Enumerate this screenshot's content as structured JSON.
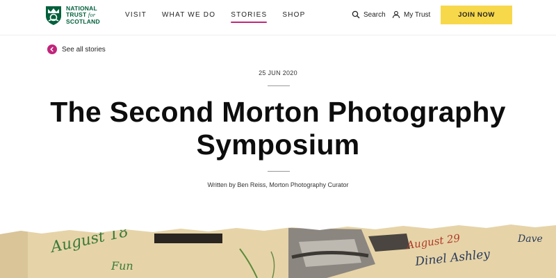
{
  "brand": {
    "line1": "NATIONAL",
    "line2_main": "TRUST",
    "line2_for": "for",
    "line3": "SCOTLAND",
    "color": "#00603c"
  },
  "nav": {
    "items": [
      {
        "label": "VISIT"
      },
      {
        "label": "WHAT WE DO"
      },
      {
        "label": "STORIES"
      },
      {
        "label": "SHOP"
      }
    ],
    "active_index": 2,
    "active_color": "#c1267b"
  },
  "utility": {
    "search_label": "Search",
    "search_icon": "search-icon",
    "mytrust_label": "My Trust",
    "mytrust_icon": "user-icon",
    "join_label": "JOIN NOW",
    "join_color": "#f7d84a"
  },
  "back_link": {
    "label": "See all stories",
    "icon": "chevron-left-icon"
  },
  "article": {
    "date": "25 JUN 2020",
    "title": "The Second Morton Photography Symposium",
    "byline": "Written by Ben Reiss, Morton Photography Curator"
  },
  "hero": {
    "handwriting": [
      "August 18",
      "Fun",
      "August 29",
      "Dinel Ashley",
      "Dave"
    ]
  }
}
